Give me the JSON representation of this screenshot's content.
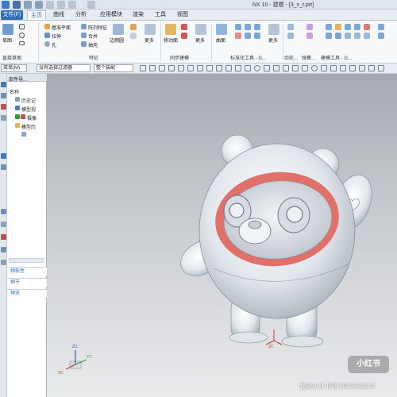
{
  "title_bar": {
    "title": "NX 10 - 建模 - [3_x_t.prt]"
  },
  "menu": {
    "file": "文件(F)",
    "tabs": [
      "主页",
      "曲线",
      "分析",
      "应用模块",
      "渲染",
      "工具",
      "视图"
    ],
    "active_tab": "主页"
  },
  "ribbon": {
    "sketch_label": "草图",
    "items": [
      "基准平面",
      "拉伸",
      "孔",
      "阵列特征",
      "合并",
      "抽壳",
      "边倒圆",
      "更多",
      "移动面",
      "更多",
      "曲面",
      "更多"
    ],
    "groups": [
      "直接草图",
      "特征",
      "同步建模",
      "标准化工具 - G...",
      "齿轮...",
      "弹簧...",
      "建模工具 - G..."
    ]
  },
  "selection_bar": {
    "menu_label": "菜单(M)",
    "filter_value": "没有选择过滤器",
    "scope_value": "整个装配"
  },
  "part_navigator": {
    "title": "部件导...",
    "column_header": "名称",
    "nodes": [
      "历史记",
      "模型视",
      "摄像",
      "模型历"
    ],
    "sections": [
      "相依性",
      "细节",
      "预览"
    ]
  },
  "viewport": {
    "badge_text": "小红书",
    "watermark": "我的小红书号:8032389249",
    "triad_labels": [
      "ZC",
      "YC",
      "XC"
    ],
    "model_csys_label": "ZC"
  },
  "colors": {
    "accent": "#2f6db5",
    "model_ring": "#e0706a",
    "model_body": "#f2f5f7"
  }
}
